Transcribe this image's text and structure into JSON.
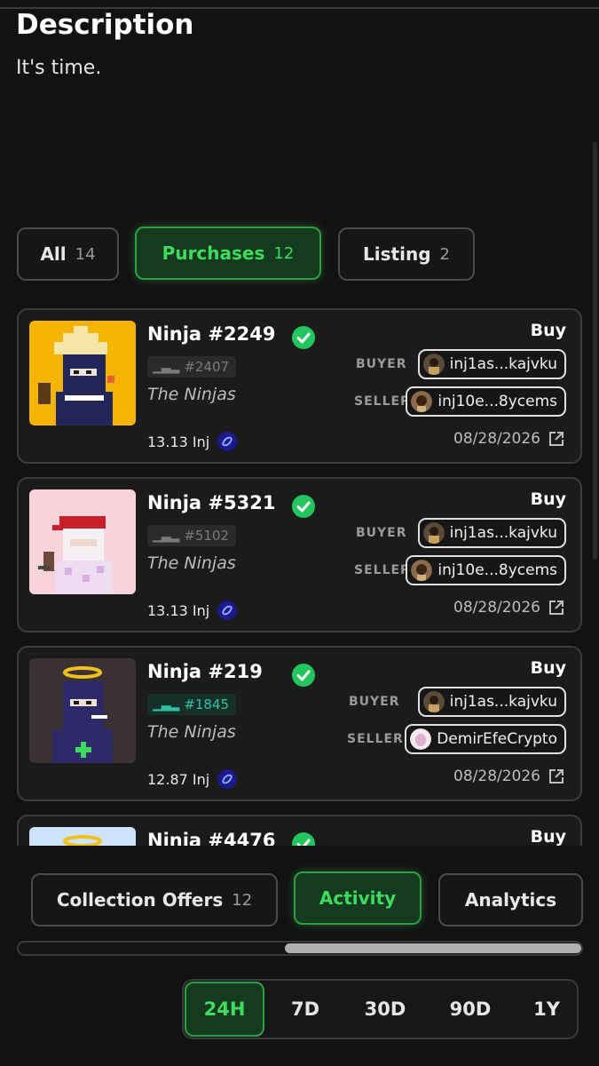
{
  "description": {
    "title": "Description",
    "text": "It's time."
  },
  "filters": [
    {
      "label": "All",
      "count": "14"
    },
    {
      "label": "Purchases",
      "count": "12"
    },
    {
      "label": "Listing",
      "count": "2"
    }
  ],
  "active_filter": "Purchases",
  "labels": {
    "buyer": "BUYER",
    "seller": "SELLER"
  },
  "items": [
    {
      "name": "Ninja #2249",
      "rank": "#2407",
      "collection": "The Ninjas",
      "price": "13.13 Inj",
      "type": "Buy",
      "buyer": "inj1as...kajvku",
      "seller": "inj10e...8ycems",
      "date": "08/28/2026"
    },
    {
      "name": "Ninja #5321",
      "rank": "#5102",
      "collection": "The Ninjas",
      "price": "13.13 Inj",
      "type": "Buy",
      "buyer": "inj1as...kajvku",
      "seller": "inj10e...8ycems",
      "date": "08/28/2026"
    },
    {
      "name": "Ninja #219",
      "rank": "#1845",
      "collection": "The Ninjas",
      "price": "12.87 Inj",
      "type": "Buy",
      "buyer": "inj1as...kajvku",
      "seller": "DemirEfeCrypto",
      "date": "08/28/2026"
    },
    {
      "name": "Ninja #4476",
      "type": "Buy"
    }
  ],
  "tabs": [
    {
      "label": "Collection Offers",
      "count": "12"
    },
    {
      "label": "Activity"
    },
    {
      "label": "Analytics"
    }
  ],
  "active_tab": "Activity",
  "periods": [
    "24H",
    "7D",
    "30D",
    "90D",
    "1Y"
  ],
  "active_period": "24H",
  "colors": {
    "accent": "#3ddc5f",
    "background": "#121212",
    "card": "#1b1b1b",
    "rank_highlight": "#2fc2a8"
  },
  "icons": {
    "verified": "verified-badge-icon",
    "rank": "bar-chart-icon",
    "currency": "injective-logo-icon",
    "external": "external-link-icon"
  }
}
